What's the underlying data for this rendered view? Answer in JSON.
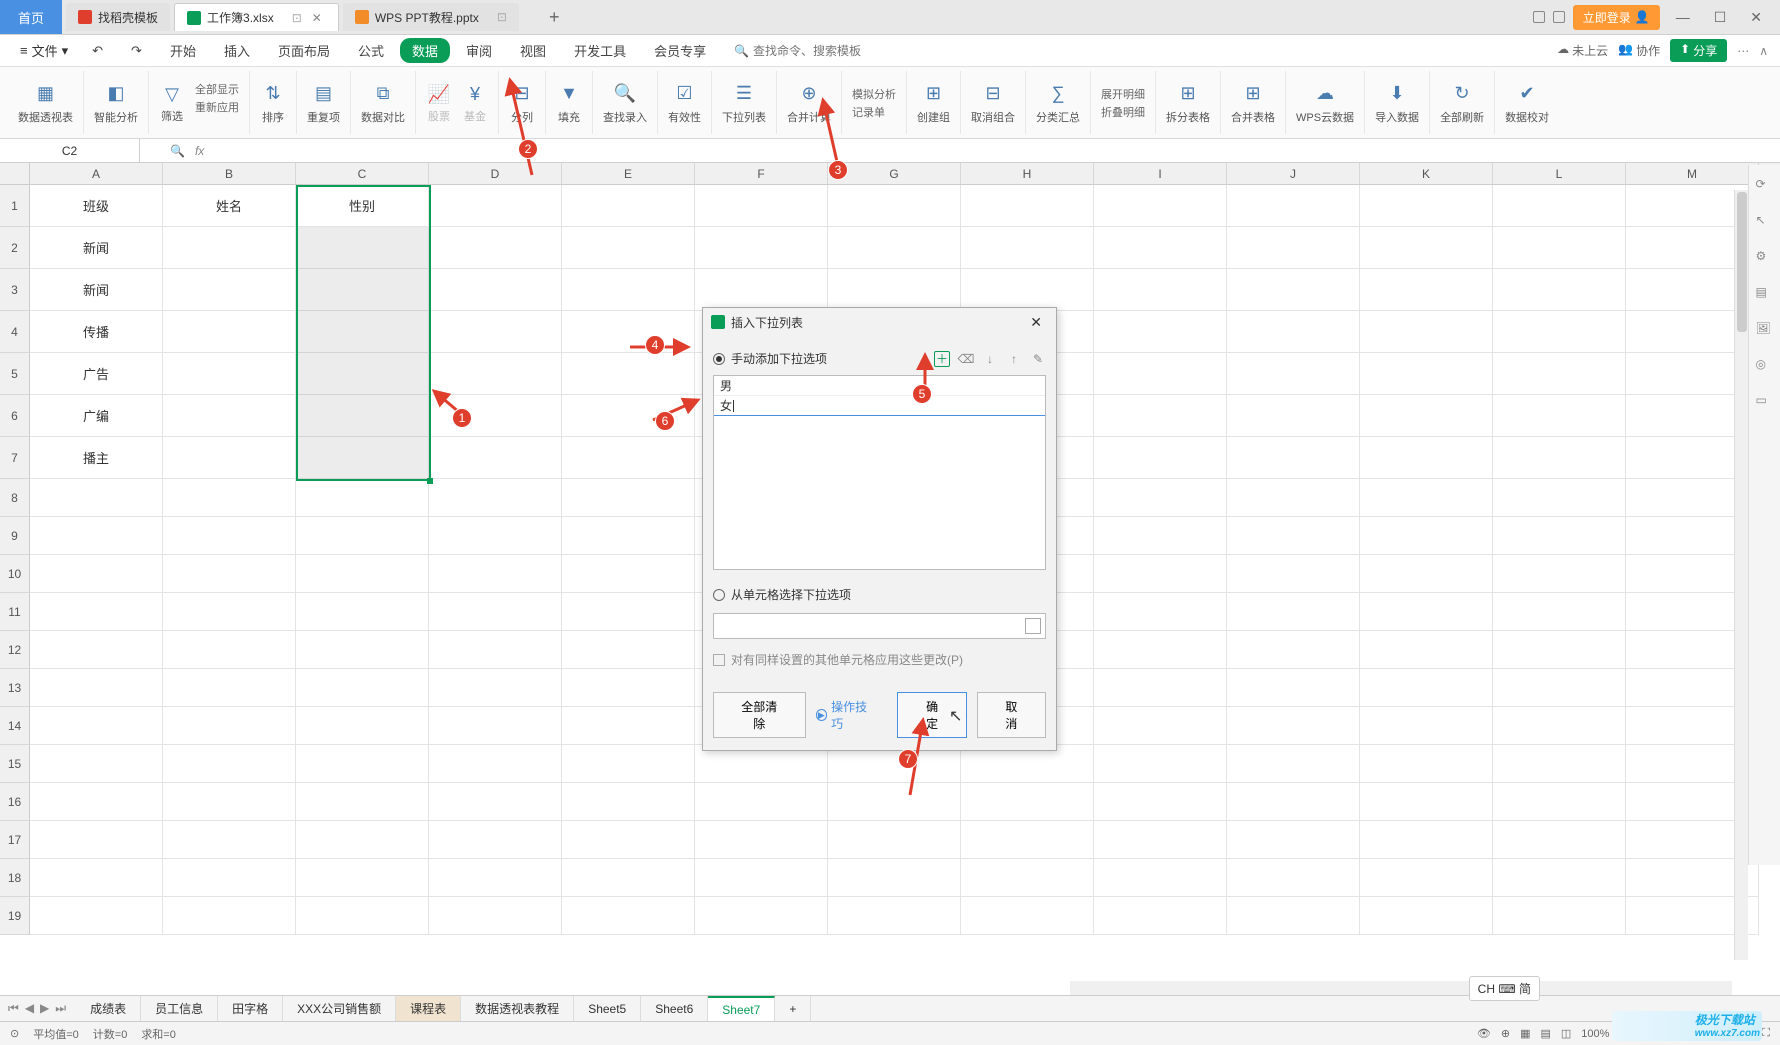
{
  "titlebar": {
    "home": "首页",
    "tabs": [
      {
        "icon": "w",
        "label": "找稻壳模板"
      },
      {
        "icon": "s",
        "label": "工作簿3.xlsx",
        "active": true
      },
      {
        "icon": "p",
        "label": "WPS PPT教程.pptx"
      }
    ],
    "login": "立即登录"
  },
  "menubar": {
    "file": "文件",
    "items": [
      "开始",
      "插入",
      "页面布局",
      "公式",
      "数据",
      "审阅",
      "视图",
      "开发工具",
      "会员专享"
    ],
    "active_index": 4,
    "search_placeholder": "查找命令、搜索模板",
    "cloud": "未上云",
    "coop": "协作",
    "share": "分享"
  },
  "ribbon": {
    "groups": [
      {
        "label": "数据透视表"
      },
      {
        "label": "智能分析"
      },
      {
        "label": "筛选",
        "sub": [
          "全部显示",
          "重新应用"
        ]
      },
      {
        "label": "排序"
      },
      {
        "label": "重复项"
      },
      {
        "label": "数据对比"
      },
      {
        "label": "股票",
        "sub2": "基金"
      },
      {
        "label": "分列"
      },
      {
        "label": "填充"
      },
      {
        "label": "查找录入"
      },
      {
        "label": "有效性"
      },
      {
        "label": "下拉列表"
      },
      {
        "label": "合并计算"
      },
      {
        "label2": "模拟分析",
        "label": "记录单"
      },
      {
        "label": "创建组"
      },
      {
        "label": "取消组合"
      },
      {
        "label": "分类汇总"
      },
      {
        "label2": "展开明细",
        "label3": "折叠明细"
      },
      {
        "label": "拆分表格"
      },
      {
        "label": "合并表格"
      },
      {
        "label": "WPS云数据"
      },
      {
        "label": "导入数据"
      },
      {
        "label": "全部刷新"
      },
      {
        "label": "数据校对"
      }
    ]
  },
  "namebox": "C2",
  "grid": {
    "cols": [
      "A",
      "B",
      "C",
      "D",
      "E",
      "F",
      "G",
      "H",
      "I",
      "J",
      "K",
      "L",
      "M"
    ],
    "rows": [
      {
        "h": "1",
        "cells": [
          "班级",
          "姓名",
          "性别"
        ]
      },
      {
        "h": "2",
        "cells": [
          "新闻",
          "",
          ""
        ]
      },
      {
        "h": "3",
        "cells": [
          "新闻",
          "",
          ""
        ]
      },
      {
        "h": "4",
        "cells": [
          "传播",
          "",
          ""
        ]
      },
      {
        "h": "5",
        "cells": [
          "广告",
          "",
          ""
        ]
      },
      {
        "h": "6",
        "cells": [
          "广编",
          "",
          ""
        ]
      },
      {
        "h": "7",
        "cells": [
          "播主",
          "",
          ""
        ]
      },
      {
        "h": "8",
        "cells": []
      },
      {
        "h": "9",
        "cells": []
      },
      {
        "h": "10",
        "cells": []
      },
      {
        "h": "11",
        "cells": []
      },
      {
        "h": "12",
        "cells": []
      },
      {
        "h": "13",
        "cells": []
      },
      {
        "h": "14",
        "cells": []
      },
      {
        "h": "15",
        "cells": []
      },
      {
        "h": "16",
        "cells": []
      },
      {
        "h": "17",
        "cells": []
      },
      {
        "h": "18",
        "cells": []
      },
      {
        "h": "19",
        "cells": []
      }
    ]
  },
  "dialog": {
    "title": "插入下拉列表",
    "radio_manual": "手动添加下拉选项",
    "radio_range": "从单元格选择下拉选项",
    "options": [
      "男",
      "女"
    ],
    "apply_same": "对有同样设置的其他单元格应用这些更改(P)",
    "clear": "全部清除",
    "tips": "操作技巧",
    "ok": "确定",
    "cancel": "取消"
  },
  "sheettabs": {
    "nav": [
      "⏮",
      "◀",
      "▶",
      "⏭"
    ],
    "tabs": [
      "成绩表",
      "员工信息",
      "田字格",
      "XXX公司销售额",
      "课程表",
      "数据透视表教程",
      "Sheet5",
      "Sheet6",
      "Sheet7"
    ],
    "active_index": 8,
    "alt_index": 4
  },
  "statusbar": {
    "left": [
      "平均值=0",
      "计数=0",
      "求和=0"
    ],
    "zoom": "100%"
  },
  "ime": "CH ⌨ 简",
  "watermark": {
    "brand": "极光下载站",
    "url": "www.xz7.com"
  }
}
